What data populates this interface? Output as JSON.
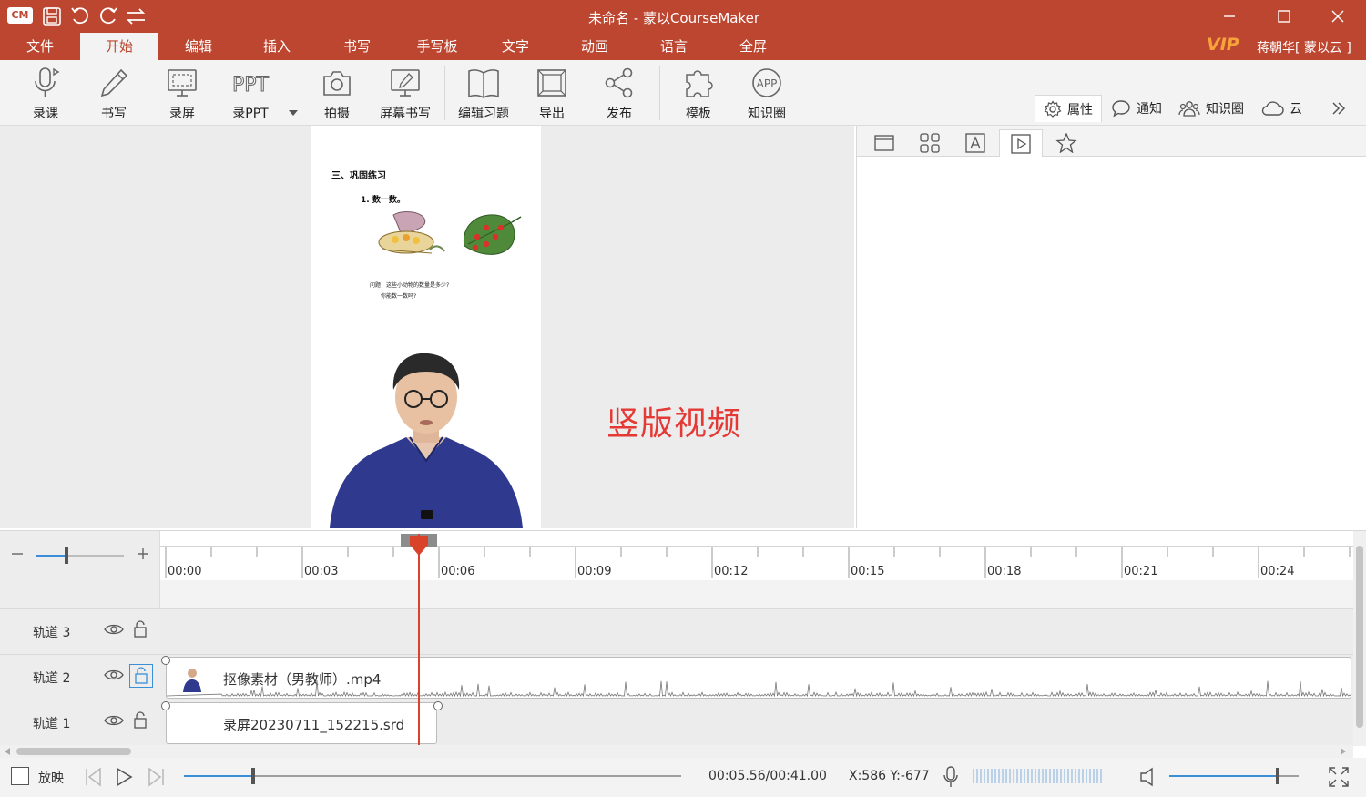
{
  "app": {
    "logo": "CM",
    "title": "未命名 - 蒙以CourseMaker",
    "vip": "VIP",
    "user": "蒋朝华[ 蒙以云 ]"
  },
  "menu": [
    "文件",
    "开始",
    "编辑",
    "插入",
    "书写",
    "手写板",
    "文字",
    "动画",
    "语言",
    "全屏"
  ],
  "menu_active_index": 1,
  "ribbon": {
    "record_course": "录课",
    "write": "书写",
    "record_screen": "录屏",
    "record_ppt": "录PPT",
    "ppt_icon_text": "PPT",
    "capture": "拍摄",
    "screen_write": "屏幕书写",
    "edit_quiz": "编辑习题",
    "export": "导出",
    "publish": "发布",
    "template": "模板",
    "knowledge_circle": "知识圈",
    "app_icon_text": "APP"
  },
  "side_tabs": {
    "properties": "属性",
    "notify": "通知",
    "knowledge_circle": "知识圈",
    "cloud": "云"
  },
  "slide": {
    "section": "三、巩固练习",
    "question": "1. 数一数。",
    "prompt_line1": "问题：这些小动物的数量是多少?",
    "prompt_line2": "你能数一数吗?"
  },
  "canvas_label": "竖版视频",
  "timeline": {
    "ticks": [
      "00:00",
      "00:03",
      "00:06",
      "00:09",
      "00:12",
      "00:15",
      "00:18",
      "00:21",
      "00:24"
    ],
    "tracks": [
      {
        "label": "轨道 3"
      },
      {
        "label": "轨道 2",
        "clip": "抠像素材（男教师）.mp4"
      },
      {
        "label": "轨道 1",
        "clip": "录屏20230711_152215.srd"
      }
    ]
  },
  "bottom": {
    "play_mode": "放映",
    "time": "00:05.56/00:41.00",
    "coords": "X:586 Y:-677",
    "progress_fraction": 0.14,
    "volume_fraction": 0.84,
    "zoom_fraction": 0.34
  },
  "colors": {
    "accent": "#bd4630",
    "label_red": "#e53935",
    "vip": "#f7a23b",
    "link_blue": "#3b8fd6"
  }
}
